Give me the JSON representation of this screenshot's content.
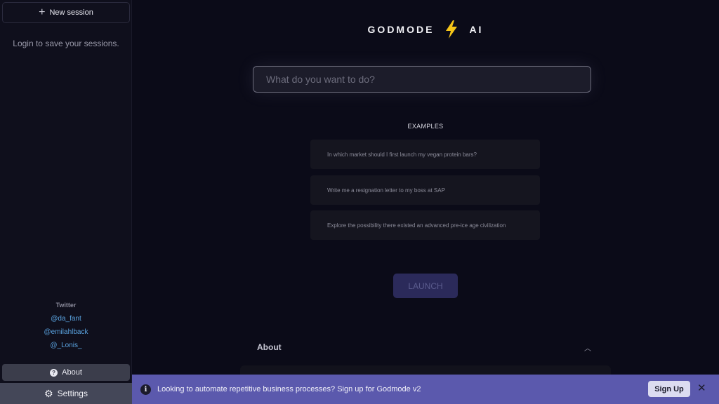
{
  "sidebar": {
    "new_session_label": "New session",
    "login_note": "Login to save your sessions.",
    "twitter_title": "Twitter",
    "twitter_links": [
      "@da_fant",
      "@emilahlback",
      "@_Lonis_"
    ],
    "about_label": "About",
    "settings_label": "Settings"
  },
  "header": {
    "brand_left": "GODMODE",
    "brand_right": "AI",
    "bolt_color": "#f5c518"
  },
  "prompt": {
    "placeholder": "What do you want to do?",
    "value": ""
  },
  "examples": {
    "title": "EXAMPLES",
    "items": [
      "In which market should I first launch my vegan protein bars?",
      "Write me a resignation letter to my boss at SAP",
      "Explore the possibility there existed an advanced pre-ice age civilization"
    ]
  },
  "launch_label": "LAUNCH",
  "about_section": {
    "title": "About"
  },
  "banner": {
    "text": "Looking to automate repetitive business processes? Sign up for Godmode v2",
    "signup_label": "Sign Up",
    "background": "#5b59ad"
  }
}
